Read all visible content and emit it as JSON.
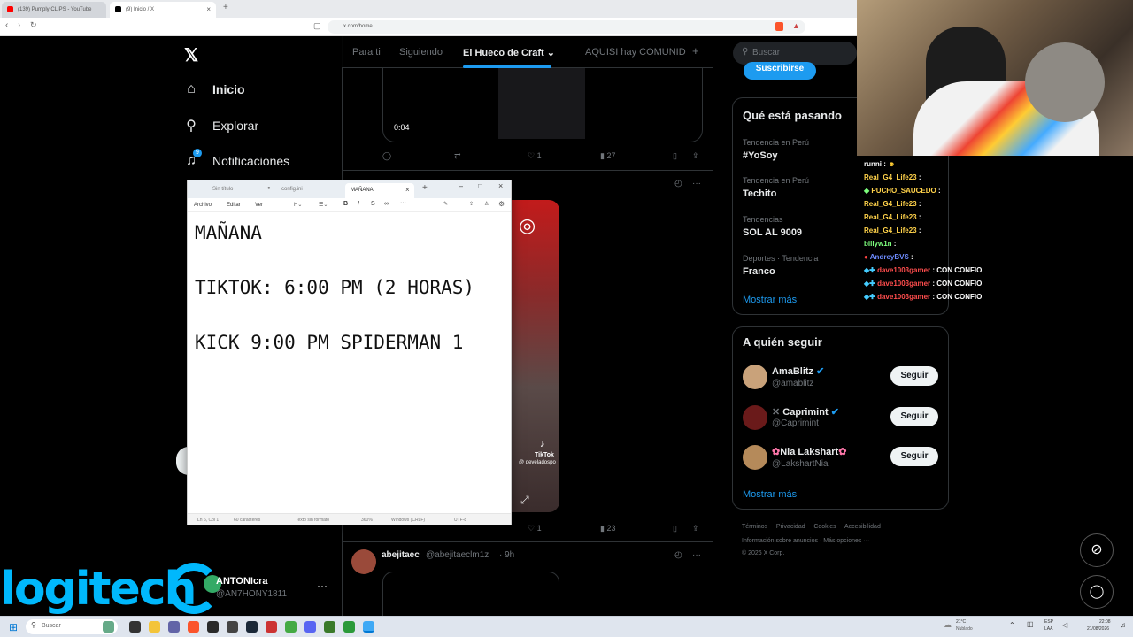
{
  "browser": {
    "tabs": [
      {
        "title": "(139) Pumply CLIPS - YouTube",
        "color": "#ff0000"
      },
      {
        "title": "(9) Inicio / X",
        "color": "#000000"
      }
    ],
    "url": "x.com/home"
  },
  "nav": {
    "items": [
      {
        "label": "Inicio",
        "icon": "home-icon"
      },
      {
        "label": "Explorar",
        "icon": "search-icon"
      },
      {
        "label": "Notificaciones",
        "icon": "bell-icon"
      }
    ],
    "badge": "9"
  },
  "account": {
    "name": "ANTONIcra",
    "handle": "@AN7HONY1811"
  },
  "feed": {
    "tabs": [
      "Para ti",
      "Siguiendo",
      "El Hueco de Craft",
      "AQUISI hay COMUNID"
    ],
    "video_time": "0:04",
    "tweet1": {
      "likes": "1",
      "views": "27"
    },
    "tweet2": {
      "likes": "1",
      "views": "23"
    },
    "tweet3": {
      "name": "abejitaec",
      "handle": "@abejitaeclm1z",
      "time": "· 9h"
    },
    "tiktok_label": "TikTok",
    "tiktok_handle": "@ develadospo"
  },
  "right": {
    "search_placeholder": "Buscar",
    "subscribe": "Suscribirse",
    "trends_title": "Qué está pasando",
    "trends": [
      {
        "cat": "Tendencia en Perú",
        "name": "#YoSoy"
      },
      {
        "cat": "Tendencia en Perú",
        "name": "Techito"
      },
      {
        "cat": "Tendencias",
        "name": "SOL AL 9009"
      },
      {
        "cat": "Deportes · Tendencia",
        "name": "Franco"
      }
    ],
    "show_more": "Mostrar más",
    "follow_title": "A quién seguir",
    "follow": [
      {
        "name": "AmaBlitz",
        "handle": "@amablitz"
      },
      {
        "name": "Caprimint",
        "handle": "@Caprimint"
      },
      {
        "name": "Nia Lakshart",
        "handle": "@LakshartNia"
      }
    ],
    "follow_btn": "Seguir",
    "footer1": [
      "Términos",
      "Privacidad",
      "Cookies",
      "Accesibilidad"
    ],
    "footer2": "Información sobre anuncios · Más opciones ···",
    "copyright": "© 2026 X Corp."
  },
  "notepad": {
    "tabs": [
      "Sin título",
      "config.ini",
      "MAÑANA"
    ],
    "menu": [
      "Archivo",
      "Editar",
      "Ver"
    ],
    "content": "MAÑANA\n\nTIKTOK: 6:00 PM (2 HORAS)\n\nKICK 9:00 PM SPIDERMAN 1",
    "status": [
      "Ln 6, Col 1",
      "60 caracteres",
      "Texto sin formato",
      "360%",
      "Windows (CRLF)",
      "UTF-8"
    ]
  },
  "chat": [
    {
      "user": "runni",
      "msg": "",
      "color": "#ffffff"
    },
    {
      "user": "Real_G4_Life23",
      "msg": "",
      "color": "#ffd24a"
    },
    {
      "user": "PUCHO_SAUCEDO",
      "msg": "",
      "color": "#ffd24a"
    },
    {
      "user": "Real_G4_Life23",
      "msg": "",
      "color": "#ffd24a"
    },
    {
      "user": "Real_G4_Life23",
      "msg": "",
      "color": "#ffd24a"
    },
    {
      "user": "Real_G4_Life23",
      "msg": "",
      "color": "#ffd24a"
    },
    {
      "user": "billyw1n",
      "msg": "",
      "color": "#7dff7d"
    },
    {
      "user": "AndreyBVS",
      "msg": "",
      "color": "#6e8cff"
    },
    {
      "user": "dave1003gamer",
      "msg": "CON CONFIO",
      "color": "#ff4d4d"
    },
    {
      "user": "dave1003gamer",
      "msg": "CON CONFIO",
      "color": "#ff4d4d"
    },
    {
      "user": "dave1003gamer",
      "msg": "CON CONFIO",
      "color": "#ff4d4d"
    }
  ],
  "overlay": {
    "brand": "logitech"
  },
  "taskbar": {
    "search": "Buscar",
    "weather": "21°C",
    "weather_desc": "Nublado",
    "lang1": "ESP",
    "lang2": "LAA",
    "time": "22:08",
    "date": "21/08/2026"
  },
  "colors": {
    "accent": "#1d9bf0",
    "logitech": "#00b8fc"
  }
}
